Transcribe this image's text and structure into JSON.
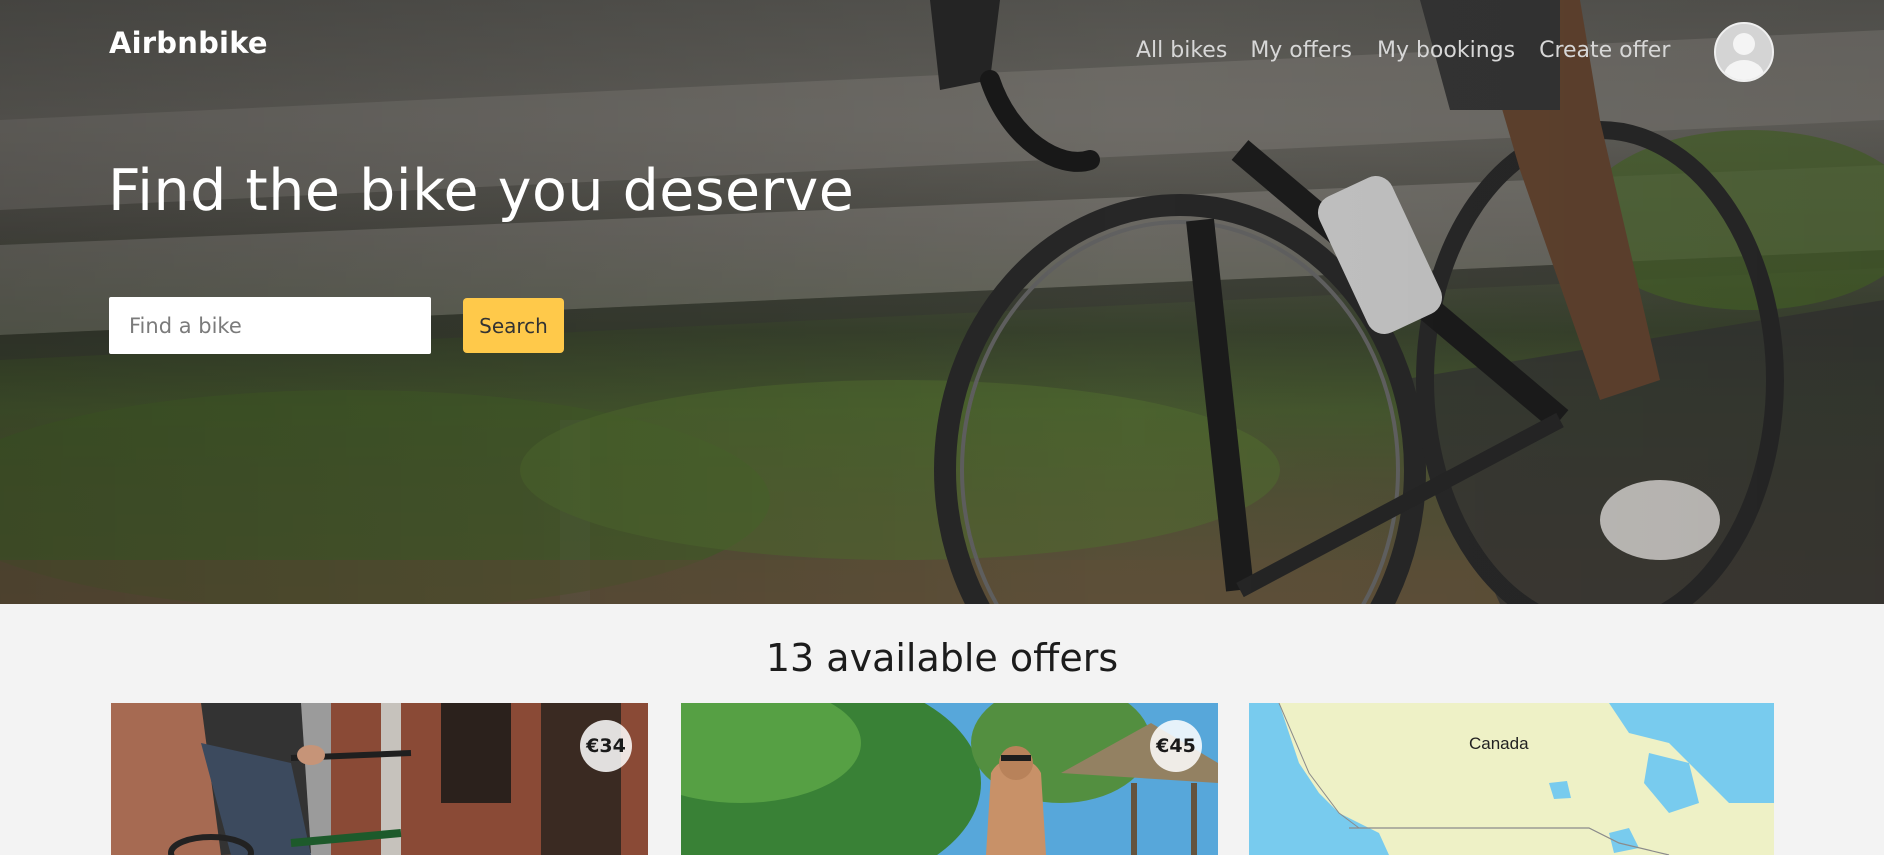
{
  "brand": "Airbnbike",
  "nav": {
    "items": [
      "All bikes",
      "My offers",
      "My bookings",
      "Create offer"
    ]
  },
  "hero": {
    "headline": "Find the bike you deserve",
    "search_placeholder": "Find a bike",
    "search_value": "",
    "search_button": "Search"
  },
  "offers": {
    "title": "13 available offers",
    "cards": [
      {
        "price": "€34"
      },
      {
        "price": "€45"
      }
    ]
  },
  "map": {
    "label": "Canada"
  },
  "colors": {
    "accent": "#ffc94a",
    "page_background": "#f3f3f3"
  },
  "icons": [
    "user-avatar-icon"
  ]
}
